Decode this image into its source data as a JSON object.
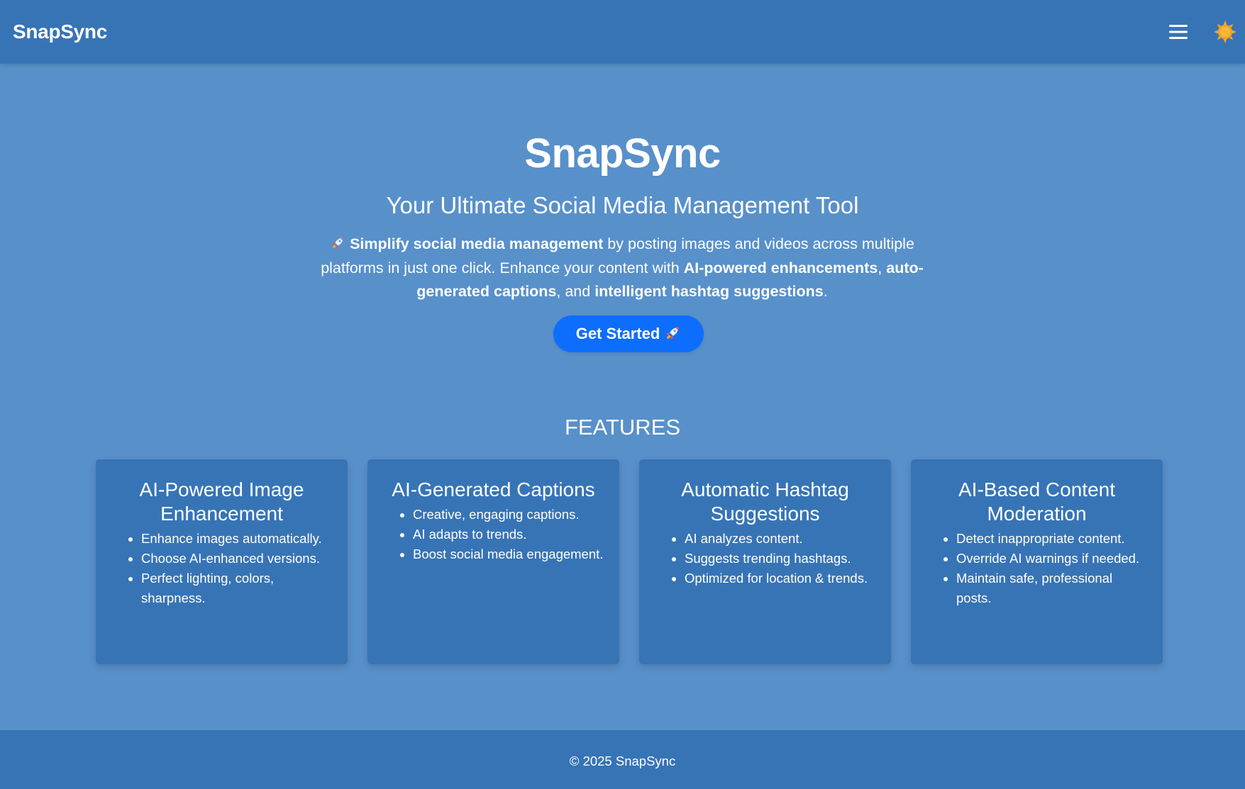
{
  "nav": {
    "brand": "SnapSync",
    "menu_icon": "hamburger-menu-icon",
    "theme_icon": "sun-icon"
  },
  "hero": {
    "title": "SnapSync",
    "subtitle": "Your Ultimate Social Media Management Tool",
    "description": {
      "icon": "rocket-icon",
      "strong_1": "Simplify social media management",
      "text_1": " by posting images and videos across multiple platforms in just one click. Enhance your content with ",
      "strong_2": "AI-powered enhancements",
      "text_2": ", ",
      "strong_3": "auto-generated captions",
      "text_3": ", and ",
      "strong_4": "intelligent hashtag suggestions",
      "text_4": "."
    },
    "cta_label": "Get Started",
    "cta_icon": "rocket-icon"
  },
  "features": {
    "heading": "FEATURES",
    "cards": [
      {
        "title": "AI-Powered Image Enhancement",
        "items": [
          "Enhance images automatically.",
          "Choose AI-enhanced versions.",
          "Perfect lighting, colors, sharpness."
        ]
      },
      {
        "title": "AI-Generated Captions",
        "items": [
          "Creative, engaging captions.",
          "AI adapts to trends.",
          "Boost social media engagement."
        ]
      },
      {
        "title": "Automatic Hashtag Suggestions",
        "items": [
          "AI analyzes content.",
          "Suggests trending hashtags.",
          "Optimized for location & trends."
        ]
      },
      {
        "title": "AI-Based Content Moderation",
        "items": [
          "Detect inappropriate content.",
          "Override AI warnings if needed.",
          "Maintain safe, professional posts."
        ]
      }
    ]
  },
  "footer": {
    "text": "© 2025 SnapSync"
  },
  "colors": {
    "page_background": "#5890ca",
    "navbar_background": "#3774b6",
    "card_background": "#3774b6",
    "cta_background": "#0d6efd",
    "text": "#ffffff",
    "sun": "#f5a623"
  }
}
